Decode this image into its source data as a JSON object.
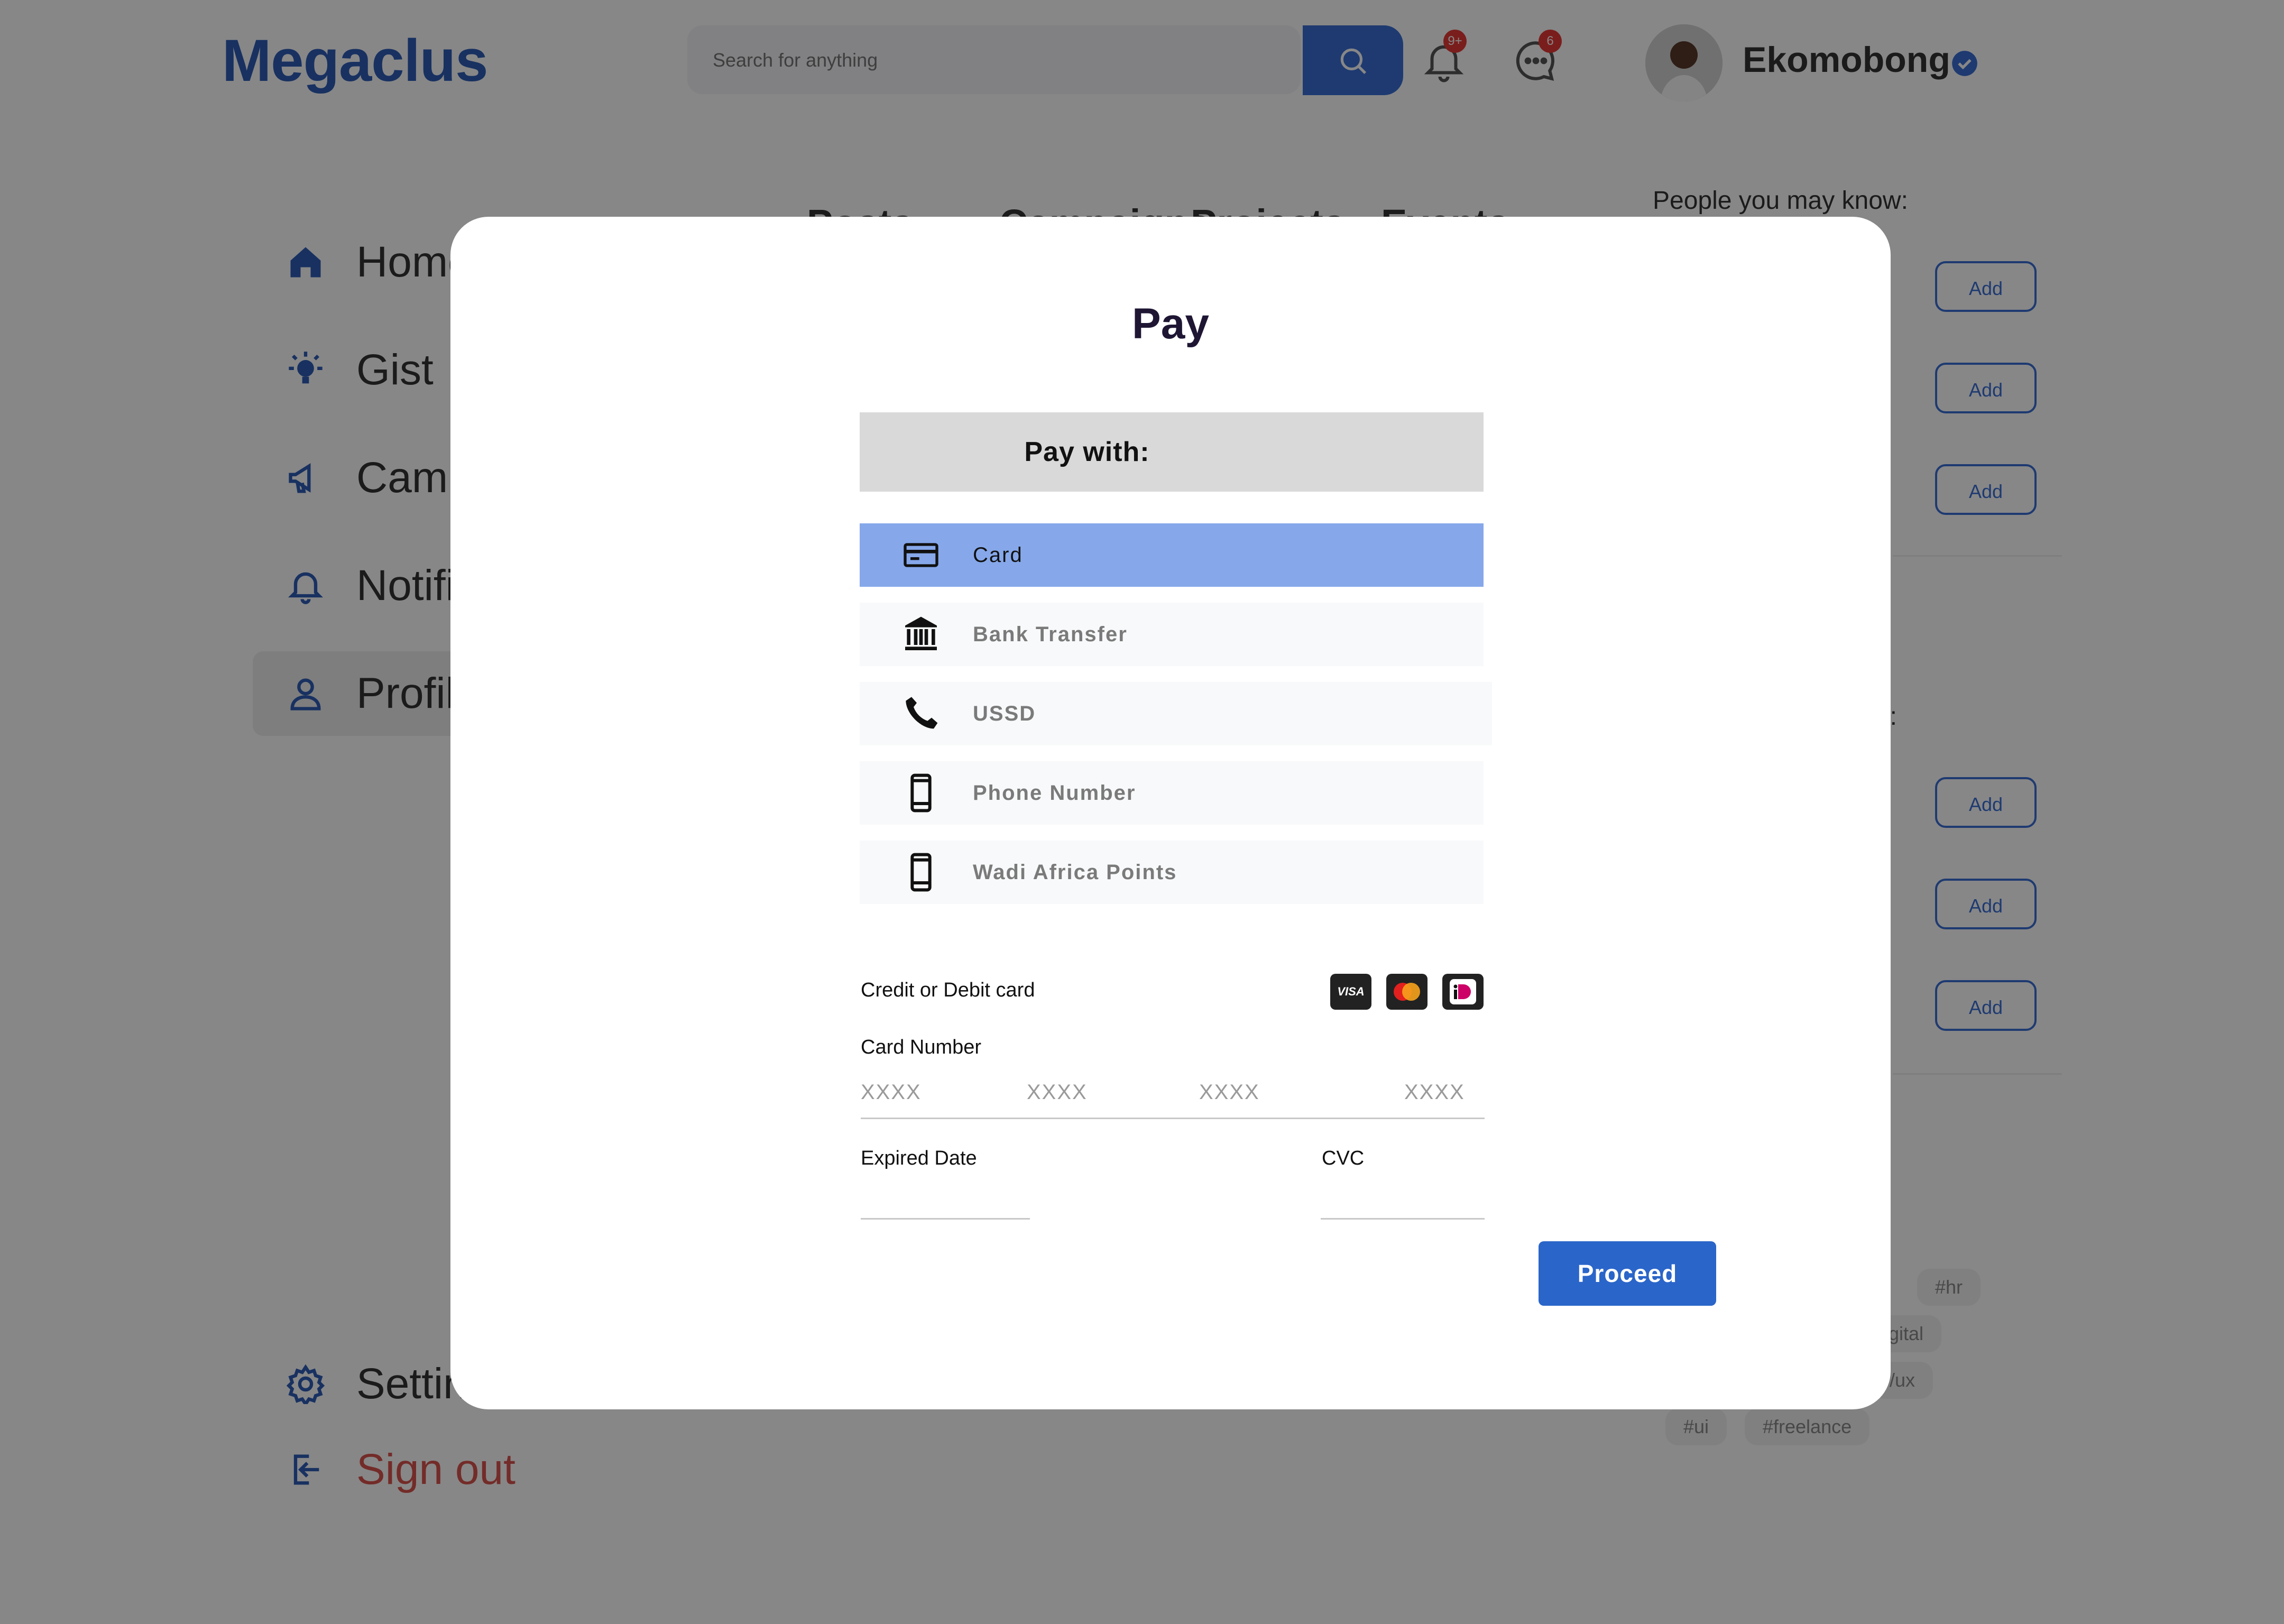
{
  "app": {
    "logo": "Megaclus",
    "search": {
      "placeholder": "Search for anything"
    },
    "notifications": {
      "badge": "9+"
    },
    "messages": {
      "badge": "6"
    },
    "user": {
      "name": "Ekomobong"
    }
  },
  "sidebar": {
    "items": [
      {
        "label": "Home",
        "icon": "home-icon"
      },
      {
        "label": "Gist",
        "icon": "lightbulb-icon"
      },
      {
        "label": "Campaigns",
        "icon": "megaphone-icon"
      },
      {
        "label": "Notifications",
        "icon": "bell-icon"
      },
      {
        "label": "Profile",
        "icon": "person-icon"
      }
    ],
    "settings": "Settings",
    "signout": "Sign out"
  },
  "feed": {
    "tabs": [
      "Posts",
      "Campaigns",
      "Projects",
      "Events"
    ]
  },
  "right": {
    "people_heading": "People you may know:",
    "heading2_partial": "w:",
    "add_label": "Add",
    "tags": [
      "#hr",
      "igital",
      "/ux",
      "#ui",
      "#freelance"
    ]
  },
  "modal": {
    "title": "Pay",
    "pay_with": "Pay with:",
    "options": [
      {
        "label": "Card",
        "icon": "credit-card-icon",
        "selected": true
      },
      {
        "label": "Bank Transfer",
        "icon": "bank-icon",
        "selected": false
      },
      {
        "label": "USSD",
        "icon": "phone-handset-icon",
        "selected": false
      },
      {
        "label": "Phone Number",
        "icon": "mobile-phone-icon",
        "selected": false
      },
      {
        "label": "Wadi Africa Points",
        "icon": "mobile-phone-icon",
        "selected": false
      }
    ],
    "card_section": {
      "title": "Credit or Debit card",
      "card_number_label": "Card Number",
      "card_number_placeholders": [
        "XXXX",
        "XXXX",
        "XXXX",
        "XXXX"
      ],
      "expiry_label": "Expired Date",
      "cvc_label": "CVC",
      "logos": [
        {
          "name": "visa-logo",
          "text": "VISA"
        },
        {
          "name": "mastercard-logo",
          "text": ""
        },
        {
          "name": "ideal-logo",
          "text": ""
        }
      ]
    },
    "proceed": "Proceed"
  },
  "colors": {
    "brand": "#2e5db8",
    "selected_option": "#86a8ea",
    "primary_button": "#2a65c9",
    "signout": "#d9534f"
  }
}
